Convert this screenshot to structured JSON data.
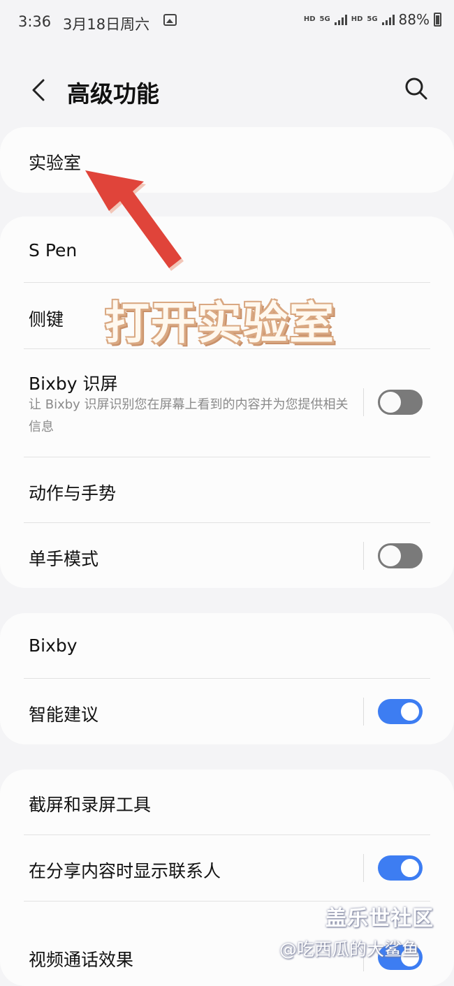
{
  "status_bar": {
    "time": "3:36",
    "date": "3月18日周六",
    "net1": "HD",
    "net2": "5G",
    "net3": "HD",
    "net4": "5G",
    "battery": "88%"
  },
  "header": {
    "title": "高级功能",
    "back_icon": "back-chevron-icon",
    "search_icon": "search-icon"
  },
  "card1": {
    "lab": "实验室"
  },
  "card2": {
    "spen": "S Pen",
    "side_key": "侧键",
    "bixby_vision": "Bixby 识屏",
    "bixby_vision_desc": "让 Bixby 识屏识别您在屏幕上看到的内容并为您提供相关信息",
    "bixby_vision_on": false,
    "motions": "动作与手势",
    "one_hand": "单手模式",
    "one_hand_on": false
  },
  "card3": {
    "bixby": "Bixby",
    "suggestions": "智能建议",
    "suggestions_on": true
  },
  "card4": {
    "screenshots": "截屏和录屏工具",
    "share_contacts": "在分享内容时显示联系人",
    "share_contacts_on": true,
    "video_call": "视频通话效果",
    "video_call_on": true
  },
  "annotation": {
    "text": "打开实验室",
    "color": "#e0443a"
  },
  "watermark": {
    "line1": "盖乐世社区",
    "line2": "@吃西瓜的大鲨鱼"
  },
  "colors": {
    "accent": "#3d7df2",
    "toggle_off": "#7a7a7a"
  }
}
